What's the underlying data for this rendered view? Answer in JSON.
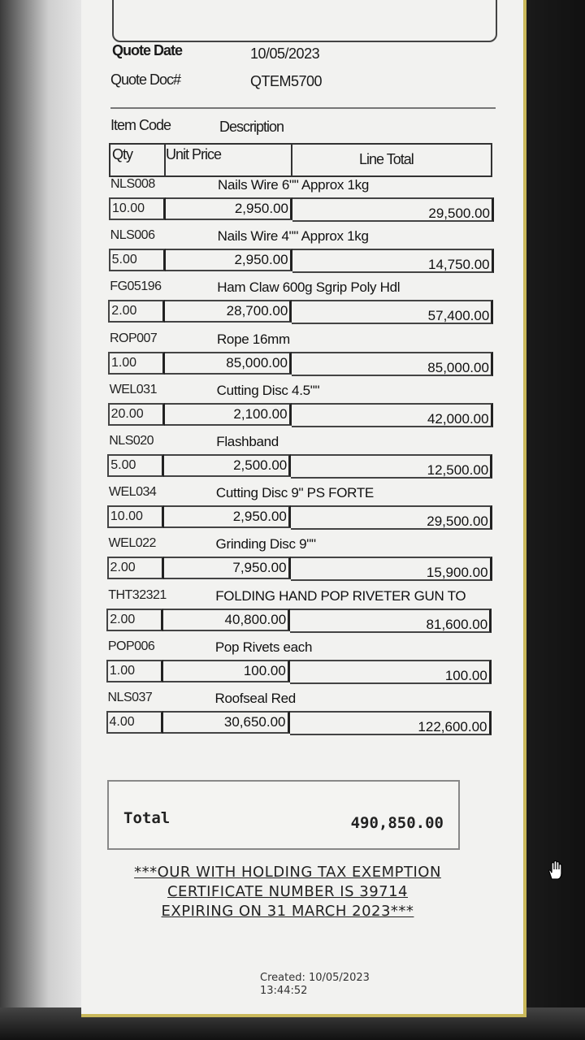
{
  "quote": {
    "date_label": "Quote Date",
    "date_value": "10/05/2023",
    "doc_label": "Quote Doc#",
    "doc_value": "QTEM5700"
  },
  "columns": {
    "item_code": "Item Code",
    "description": "Description",
    "qty": "Qty",
    "unit_price": "Unit Price",
    "line_total": "Line Total"
  },
  "items": [
    {
      "code": "NLS008",
      "description": "Nails Wire 6\"\" Approx 1kg",
      "qty": "10.00",
      "unit_price": "2,950.00",
      "line_total": "29,500.00"
    },
    {
      "code": "NLS006",
      "description": "Nails Wire 4\"\" Approx 1kg",
      "qty": "5.00",
      "unit_price": "2,950.00",
      "line_total": "14,750.00"
    },
    {
      "code": "FG05196",
      "description": "Ham Claw 600g Sgrip Poly Hdl",
      "qty": "2.00",
      "unit_price": "28,700.00",
      "line_total": "57,400.00"
    },
    {
      "code": "ROP007",
      "description": "Rope 16mm",
      "qty": "1.00",
      "unit_price": "85,000.00",
      "line_total": "85,000.00"
    },
    {
      "code": "WEL031",
      "description": "Cutting Disc 4.5\"\"",
      "qty": "20.00",
      "unit_price": "2,100.00",
      "line_total": "42,000.00"
    },
    {
      "code": "NLS020",
      "description": "Flashband",
      "qty": "5.00",
      "unit_price": "2,500.00",
      "line_total": "12,500.00"
    },
    {
      "code": "WEL034",
      "description": "Cutting Disc 9\" PS FORTE",
      "qty": "10.00",
      "unit_price": "2,950.00",
      "line_total": "29,500.00"
    },
    {
      "code": "WEL022",
      "description": "Grinding Disc 9\"\"",
      "qty": "2.00",
      "unit_price": "7,950.00",
      "line_total": "15,900.00"
    },
    {
      "code": "THT32321",
      "description": "FOLDING HAND POP RIVETER GUN TO",
      "qty": "2.00",
      "unit_price": "40,800.00",
      "line_total": "81,600.00"
    },
    {
      "code": "POP006",
      "description": "Pop Rivets each",
      "qty": "1.00",
      "unit_price": "100.00",
      "line_total": "100.00"
    },
    {
      "code": "NLS037",
      "description": "Roofseal Red",
      "qty": "4.00",
      "unit_price": "30,650.00",
      "line_total": "122,600.00"
    }
  ],
  "total": {
    "label": "Total",
    "value": "490,850.00"
  },
  "notice": {
    "line1": "***OUR WITH HOLDING TAX EXEMPTION",
    "line2": "CERTIFICATE NUMBER IS 39714",
    "line3": "EXPIRING ON 31 MARCH 2023***"
  },
  "created": {
    "line1": "Created: 10/05/2023",
    "line2": "13:44:52"
  }
}
